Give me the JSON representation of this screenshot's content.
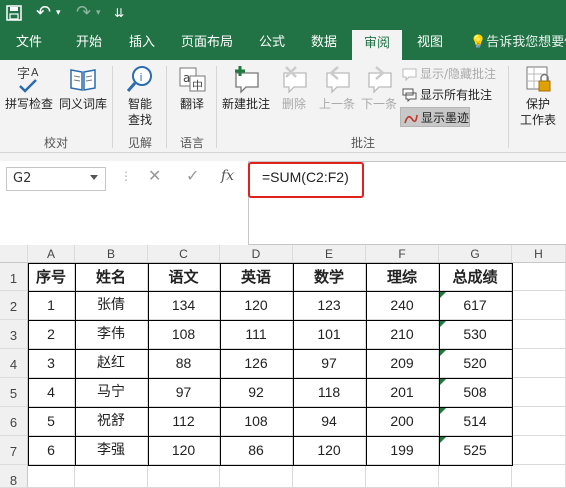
{
  "quick_access": {
    "undo_glyph": "↶",
    "redo_glyph": "↷",
    "more_glyph": "⇊"
  },
  "tabs": [
    "文件",
    "开始",
    "插入",
    "页面布局",
    "公式",
    "数据",
    "审阅",
    "视图"
  ],
  "active_tab": "审阅",
  "tell_me": "告诉我您想要做",
  "ribbon": {
    "proofing": {
      "spell": "拼写检查",
      "thesaurus": "同义词库",
      "group": "校对"
    },
    "insights": {
      "smart_lookup_1": "智能",
      "smart_lookup_2": "查找",
      "group": "见解"
    },
    "language": {
      "translate": "翻译",
      "group": "语言"
    },
    "comments": {
      "new": "新建批注",
      "delete": "删除",
      "prev": "上一条",
      "next": "下一条",
      "show_hide": "显示/隐藏批注",
      "show_all": "显示所有批注",
      "show_ink": "显示墨迹",
      "group": "批注"
    },
    "protect": {
      "line1": "保护",
      "line2": "工作表"
    }
  },
  "formula_bar": {
    "name_box": "G2",
    "cancel": "✕",
    "enter": "✓",
    "fx": "fx",
    "formula": "=SUM(C2:F2)"
  },
  "grid": {
    "columns": [
      "A",
      "B",
      "C",
      "D",
      "E",
      "F",
      "G",
      "H"
    ],
    "row_numbers": [
      "1",
      "2",
      "3",
      "4",
      "5",
      "6",
      "7",
      "8"
    ],
    "header": [
      "序号",
      "姓名",
      "语文",
      "英语",
      "数学",
      "理综",
      "总成绩"
    ],
    "rows": [
      [
        "1",
        "张倩",
        "134",
        "120",
        "123",
        "240",
        "617"
      ],
      [
        "2",
        "李伟",
        "108",
        "111",
        "101",
        "210",
        "530"
      ],
      [
        "3",
        "赵红",
        "88",
        "126",
        "97",
        "209",
        "520"
      ],
      [
        "4",
        "马宁",
        "97",
        "92",
        "118",
        "201",
        "508"
      ],
      [
        "5",
        "祝舒",
        "112",
        "108",
        "94",
        "200",
        "514"
      ],
      [
        "6",
        "李强",
        "120",
        "86",
        "120",
        "199",
        "525"
      ]
    ]
  },
  "colors": {
    "excel_green": "#217346",
    "highlight_red": "#e0221f"
  }
}
